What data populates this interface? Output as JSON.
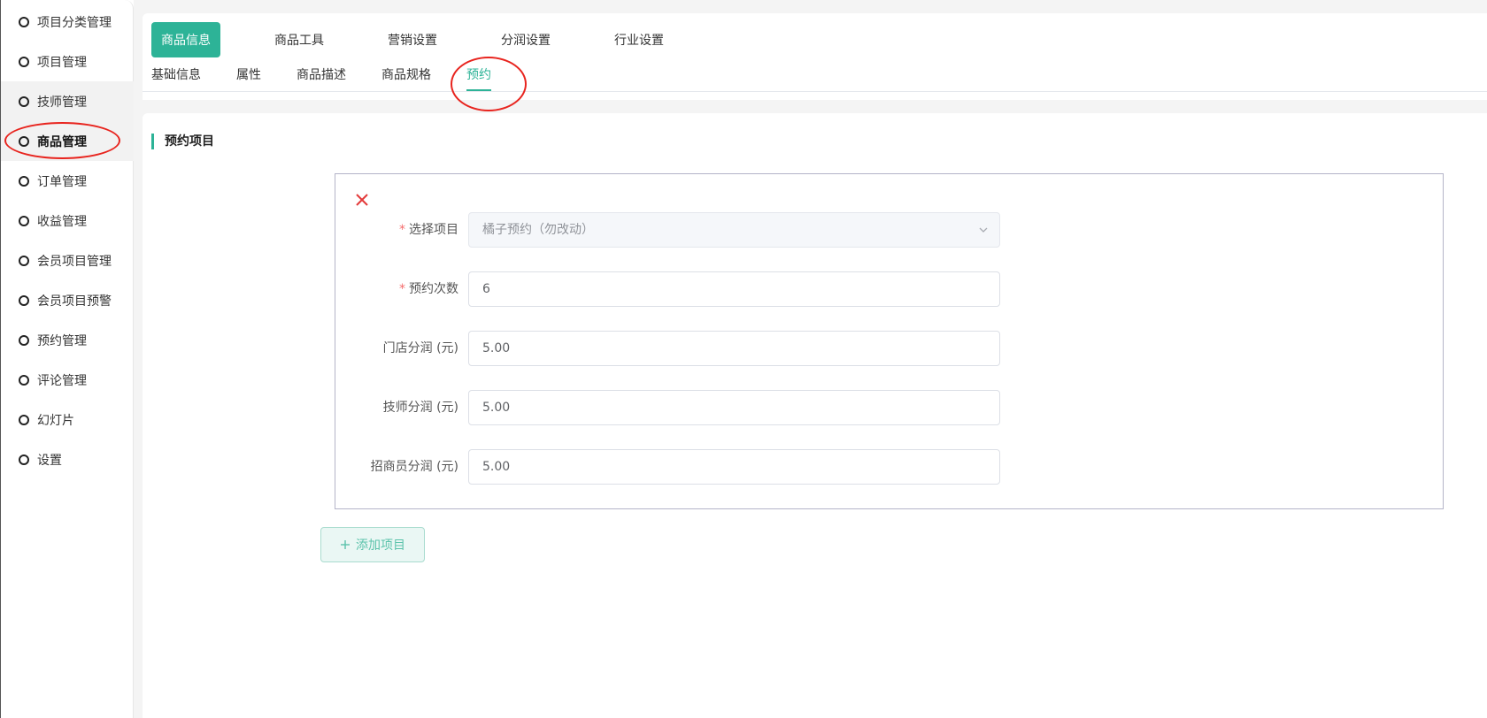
{
  "sidebar": {
    "items": [
      {
        "label": "项目分类管理"
      },
      {
        "label": "项目管理"
      },
      {
        "label": "技师管理"
      },
      {
        "label": "商品管理"
      },
      {
        "label": "订单管理"
      },
      {
        "label": "收益管理"
      },
      {
        "label": "会员项目管理"
      },
      {
        "label": "会员项目预警"
      },
      {
        "label": "预约管理"
      },
      {
        "label": "评论管理"
      },
      {
        "label": "幻灯片"
      },
      {
        "label": "设置"
      }
    ]
  },
  "top_tabs": [
    {
      "label": "商品信息"
    },
    {
      "label": "商品工具"
    },
    {
      "label": "营销设置"
    },
    {
      "label": "分润设置"
    },
    {
      "label": "行业设置"
    }
  ],
  "sub_tabs": [
    {
      "label": "基础信息"
    },
    {
      "label": "属性"
    },
    {
      "label": "商品描述"
    },
    {
      "label": "商品规格"
    },
    {
      "label": "预约"
    }
  ],
  "section": {
    "title": "预约项目"
  },
  "form": {
    "select_project": {
      "label": "选择项目",
      "value": "橘子预约（勿改动）"
    },
    "booking_count": {
      "label": "预约次数",
      "value": "6"
    },
    "store_share": {
      "label": "门店分润 (元)",
      "value": "5.00"
    },
    "tech_share": {
      "label": "技师分润 (元)",
      "value": "5.00"
    },
    "merchant_share": {
      "label": "招商员分润 (元)",
      "value": "5.00"
    }
  },
  "add_button": {
    "label": "添加项目"
  },
  "colors": {
    "accent": "#2db397",
    "annotation": "#e8241e",
    "delete": "#e33a3a"
  }
}
